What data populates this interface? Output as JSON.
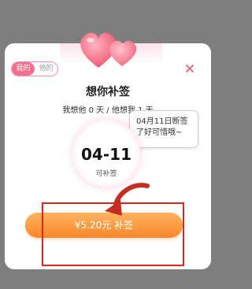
{
  "dialog": {
    "tabs": [
      {
        "label": "我的"
      },
      {
        "label": "他的"
      }
    ],
    "title": "想你补签",
    "subtitle": "我想他 0 天 / 他想我 1 天",
    "bubble_text": "04月11日断签了好可惜哦~",
    "circle": {
      "date": "04-11",
      "label": "可补签"
    },
    "cta_label": "¥5.20元 补签"
  },
  "colors": {
    "accent_pink": "#f36f8d",
    "cta_orange": "#f7882b",
    "highlight_red": "#e1231e"
  }
}
